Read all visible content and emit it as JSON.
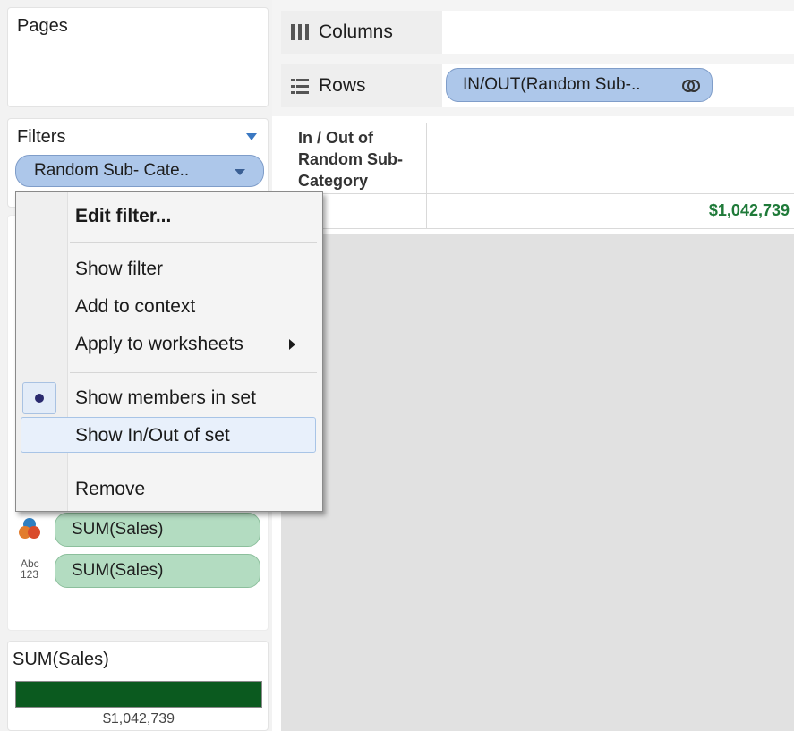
{
  "pages_panel": {
    "title": "Pages"
  },
  "columns_shelf": {
    "label": "Columns",
    "icon": "columns-icon"
  },
  "rows_shelf": {
    "label": "Rows",
    "icon": "rows-icon",
    "pill_label": "IN/OUT(Random Sub-.."
  },
  "filters_panel": {
    "title": "Filters",
    "pill_label": "Random Sub- Cate.."
  },
  "context_menu": {
    "items": [
      {
        "label": "Edit filter...",
        "bold": true
      },
      {
        "label": "Show filter"
      },
      {
        "label": "Add to context"
      },
      {
        "label": "Apply to worksheets",
        "has_submenu": true
      },
      {
        "label": "Show members in set",
        "selected": true
      },
      {
        "label": "Show In/Out of set",
        "hovered": true
      },
      {
        "label": "Remove"
      }
    ]
  },
  "marks": {
    "color_pill": "SUM(Sales)",
    "label_pill": "SUM(Sales)",
    "text_icon_top": "Abc",
    "text_icon_bottom": "123"
  },
  "table": {
    "header": "In / Out of\nRandom Sub-\nCategory",
    "value": "$1,042,739"
  },
  "legend": {
    "title": "SUM(Sales)",
    "value": "$1,042,739",
    "bar_color": "#0b5a1f"
  },
  "colors": {
    "pill_blue": "#adc7ea",
    "pill_green": "#b3dcc1",
    "value_green": "#1f7a39"
  }
}
